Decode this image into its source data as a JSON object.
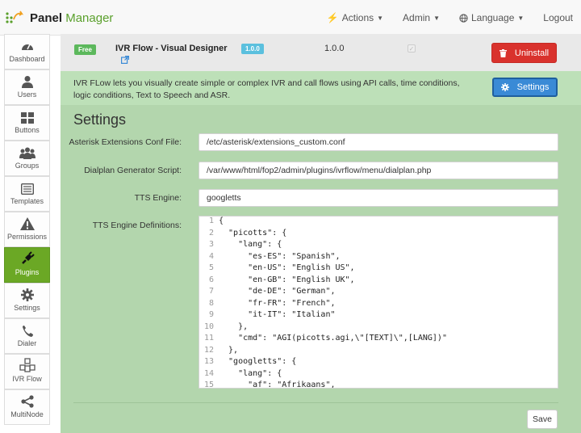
{
  "brand": {
    "bold": "Panel",
    "light": "Manager"
  },
  "nav": {
    "actions": "Actions",
    "admin": "Admin",
    "language": "Language",
    "logout": "Logout"
  },
  "sidebar": {
    "items": [
      {
        "label": "Dashboard",
        "icon": "dashboard-icon"
      },
      {
        "label": "Users",
        "icon": "user-icon"
      },
      {
        "label": "Buttons",
        "icon": "grid-icon"
      },
      {
        "label": "Groups",
        "icon": "groups-icon"
      },
      {
        "label": "Templates",
        "icon": "template-icon"
      },
      {
        "label": "Permissions",
        "icon": "warning-icon"
      },
      {
        "label": "Plugins",
        "icon": "plug-icon",
        "active": true
      },
      {
        "label": "Settings",
        "icon": "gear-icon"
      },
      {
        "label": "Dialer",
        "icon": "phone-icon"
      },
      {
        "label": "IVR Flow",
        "icon": "cubes-icon"
      },
      {
        "label": "MultiNode",
        "icon": "share-icon"
      }
    ]
  },
  "plugin": {
    "badge": "Free",
    "name": "IVR Flow - Visual Designer",
    "version_badge": "1.0.0",
    "version": "1.0.0",
    "uninstall_label": "Uninstall",
    "description": "IVR FLow lets you visually create simple or complex IVR and call flows using API calls, time conditions, logic conditions, Text to Speech and ASR.",
    "settings_label": "Settings"
  },
  "settings": {
    "title": "Settings",
    "fields": {
      "extensions_label": "Asterisk Extensions Conf File:",
      "extensions_value": "/etc/asterisk/extensions_custom.conf",
      "dialplan_label": "Dialplan Generator Script:",
      "dialplan_value": "/var/www/html/fop2/admin/plugins/ivrflow/menu/dialplan.php",
      "tts_label": "TTS Engine:",
      "tts_value": "googletts",
      "defs_label": "TTS Engine Definitions:"
    },
    "code_lines": [
      {
        "n": "1",
        "t": "{"
      },
      {
        "n": "2",
        "t": "  \"picotts\": {"
      },
      {
        "n": "3",
        "t": "    \"lang\": {"
      },
      {
        "n": "4",
        "t": "      \"es-ES\": \"Spanish\","
      },
      {
        "n": "5",
        "t": "      \"en-US\": \"English US\","
      },
      {
        "n": "6",
        "t": "      \"en-GB\": \"English UK\","
      },
      {
        "n": "7",
        "t": "      \"de-DE\": \"German\","
      },
      {
        "n": "8",
        "t": "      \"fr-FR\": \"French\","
      },
      {
        "n": "9",
        "t": "      \"it-IT\": \"Italian\""
      },
      {
        "n": "10",
        "t": "    },"
      },
      {
        "n": "11",
        "t": "    \"cmd\": \"AGI(picotts.agi,\\\"[TEXT]\\\",[LANG])\""
      },
      {
        "n": "12",
        "t": "  },"
      },
      {
        "n": "13",
        "t": "  \"googletts\": {"
      },
      {
        "n": "14",
        "t": "    \"lang\": {"
      },
      {
        "n": "15",
        "t": "      \"af\": \"Afrikaans\","
      }
    ],
    "save_label": "Save"
  },
  "colors": {
    "brand_green": "#5aa02c",
    "active_nav": "#6ba825",
    "danger": "#d9322d",
    "primary": "#3a8ad6",
    "panel_green": "#b3d6ad"
  }
}
